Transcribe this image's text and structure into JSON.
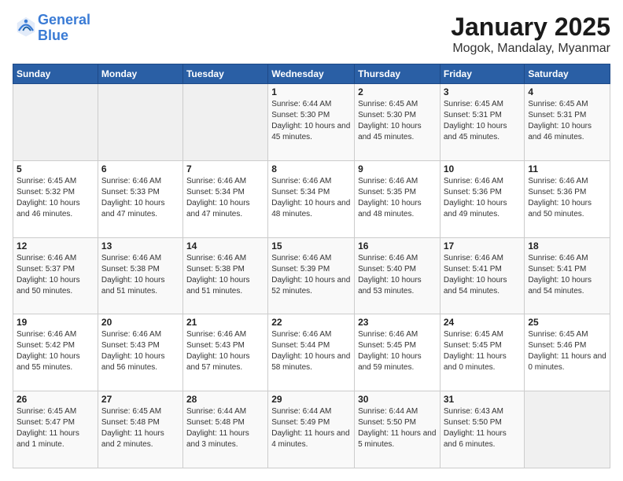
{
  "header": {
    "logo_line1": "General",
    "logo_line2": "Blue",
    "title": "January 2025",
    "subtitle": "Mogok, Mandalay, Myanmar"
  },
  "days_of_week": [
    "Sunday",
    "Monday",
    "Tuesday",
    "Wednesday",
    "Thursday",
    "Friday",
    "Saturday"
  ],
  "weeks": [
    [
      {
        "day": "",
        "info": ""
      },
      {
        "day": "",
        "info": ""
      },
      {
        "day": "",
        "info": ""
      },
      {
        "day": "1",
        "info": "Sunrise: 6:44 AM\nSunset: 5:30 PM\nDaylight: 10 hours and 45 minutes."
      },
      {
        "day": "2",
        "info": "Sunrise: 6:45 AM\nSunset: 5:30 PM\nDaylight: 10 hours and 45 minutes."
      },
      {
        "day": "3",
        "info": "Sunrise: 6:45 AM\nSunset: 5:31 PM\nDaylight: 10 hours and 45 minutes."
      },
      {
        "day": "4",
        "info": "Sunrise: 6:45 AM\nSunset: 5:31 PM\nDaylight: 10 hours and 46 minutes."
      }
    ],
    [
      {
        "day": "5",
        "info": "Sunrise: 6:45 AM\nSunset: 5:32 PM\nDaylight: 10 hours and 46 minutes."
      },
      {
        "day": "6",
        "info": "Sunrise: 6:46 AM\nSunset: 5:33 PM\nDaylight: 10 hours and 47 minutes."
      },
      {
        "day": "7",
        "info": "Sunrise: 6:46 AM\nSunset: 5:34 PM\nDaylight: 10 hours and 47 minutes."
      },
      {
        "day": "8",
        "info": "Sunrise: 6:46 AM\nSunset: 5:34 PM\nDaylight: 10 hours and 48 minutes."
      },
      {
        "day": "9",
        "info": "Sunrise: 6:46 AM\nSunset: 5:35 PM\nDaylight: 10 hours and 48 minutes."
      },
      {
        "day": "10",
        "info": "Sunrise: 6:46 AM\nSunset: 5:36 PM\nDaylight: 10 hours and 49 minutes."
      },
      {
        "day": "11",
        "info": "Sunrise: 6:46 AM\nSunset: 5:36 PM\nDaylight: 10 hours and 50 minutes."
      }
    ],
    [
      {
        "day": "12",
        "info": "Sunrise: 6:46 AM\nSunset: 5:37 PM\nDaylight: 10 hours and 50 minutes."
      },
      {
        "day": "13",
        "info": "Sunrise: 6:46 AM\nSunset: 5:38 PM\nDaylight: 10 hours and 51 minutes."
      },
      {
        "day": "14",
        "info": "Sunrise: 6:46 AM\nSunset: 5:38 PM\nDaylight: 10 hours and 51 minutes."
      },
      {
        "day": "15",
        "info": "Sunrise: 6:46 AM\nSunset: 5:39 PM\nDaylight: 10 hours and 52 minutes."
      },
      {
        "day": "16",
        "info": "Sunrise: 6:46 AM\nSunset: 5:40 PM\nDaylight: 10 hours and 53 minutes."
      },
      {
        "day": "17",
        "info": "Sunrise: 6:46 AM\nSunset: 5:41 PM\nDaylight: 10 hours and 54 minutes."
      },
      {
        "day": "18",
        "info": "Sunrise: 6:46 AM\nSunset: 5:41 PM\nDaylight: 10 hours and 54 minutes."
      }
    ],
    [
      {
        "day": "19",
        "info": "Sunrise: 6:46 AM\nSunset: 5:42 PM\nDaylight: 10 hours and 55 minutes."
      },
      {
        "day": "20",
        "info": "Sunrise: 6:46 AM\nSunset: 5:43 PM\nDaylight: 10 hours and 56 minutes."
      },
      {
        "day": "21",
        "info": "Sunrise: 6:46 AM\nSunset: 5:43 PM\nDaylight: 10 hours and 57 minutes."
      },
      {
        "day": "22",
        "info": "Sunrise: 6:46 AM\nSunset: 5:44 PM\nDaylight: 10 hours and 58 minutes."
      },
      {
        "day": "23",
        "info": "Sunrise: 6:46 AM\nSunset: 5:45 PM\nDaylight: 10 hours and 59 minutes."
      },
      {
        "day": "24",
        "info": "Sunrise: 6:45 AM\nSunset: 5:45 PM\nDaylight: 11 hours and 0 minutes."
      },
      {
        "day": "25",
        "info": "Sunrise: 6:45 AM\nSunset: 5:46 PM\nDaylight: 11 hours and 0 minutes."
      }
    ],
    [
      {
        "day": "26",
        "info": "Sunrise: 6:45 AM\nSunset: 5:47 PM\nDaylight: 11 hours and 1 minute."
      },
      {
        "day": "27",
        "info": "Sunrise: 6:45 AM\nSunset: 5:48 PM\nDaylight: 11 hours and 2 minutes."
      },
      {
        "day": "28",
        "info": "Sunrise: 6:44 AM\nSunset: 5:48 PM\nDaylight: 11 hours and 3 minutes."
      },
      {
        "day": "29",
        "info": "Sunrise: 6:44 AM\nSunset: 5:49 PM\nDaylight: 11 hours and 4 minutes."
      },
      {
        "day": "30",
        "info": "Sunrise: 6:44 AM\nSunset: 5:50 PM\nDaylight: 11 hours and 5 minutes."
      },
      {
        "day": "31",
        "info": "Sunrise: 6:43 AM\nSunset: 5:50 PM\nDaylight: 11 hours and 6 minutes."
      },
      {
        "day": "",
        "info": ""
      }
    ]
  ]
}
